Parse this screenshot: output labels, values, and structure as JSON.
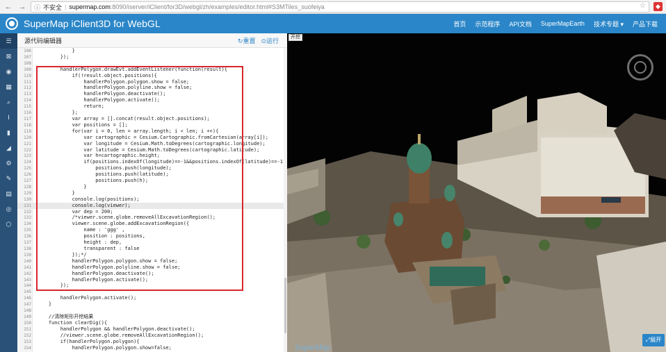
{
  "browser": {
    "back_icon": "arrow-left",
    "forward_icon": "arrow-right",
    "security_label": "不安全",
    "url_host": "supermap.com",
    "url_path": ":8090/iserver/iClient/for3D/webgl/zh/examples/editor.html#S3MTiles_suofeiya",
    "star_icon": "star"
  },
  "header": {
    "title": "SuperMap iClient3D for WebGL",
    "nav": [
      "首页",
      "示范程序",
      "API文档",
      "SuperMapEarth",
      "技术专题 ▾",
      "产品下载"
    ]
  },
  "sidebar": {
    "items": [
      "☰",
      "⊠",
      "◉",
      "▦",
      "⌕",
      "Ⅰ",
      "▮",
      "◢",
      "⚙",
      "✎",
      "▤",
      "◎",
      "⬡"
    ]
  },
  "editor": {
    "title": "源代码编辑器",
    "reset_label": "↻重置",
    "run_label": "⊙运行",
    "lines": [
      {
        "no": "106",
        "code": "            }"
      },
      {
        "no": "107",
        "code": "        });"
      },
      {
        "no": "108",
        "code": ""
      },
      {
        "no": "109",
        "code": "        handlerPolygon.drawEvt.addEventListener(function(result){"
      },
      {
        "no": "110",
        "code": "            if(!result.object.positions){"
      },
      {
        "no": "111",
        "code": "                handlerPolygon.polygon.show = false;"
      },
      {
        "no": "112",
        "code": "                handlerPolygon.polyline.show = false;"
      },
      {
        "no": "113",
        "code": "                handlerPolygon.deactivate();"
      },
      {
        "no": "114",
        "code": "                handlerPolygon.activate();"
      },
      {
        "no": "115",
        "code": "                return;"
      },
      {
        "no": "116",
        "code": "            };"
      },
      {
        "no": "117",
        "code": "            var array = [].concat(result.object.positions);"
      },
      {
        "no": "118",
        "code": "            var positions = [];"
      },
      {
        "no": "119",
        "code": "            for(var i = 0, len = array.length; i < len; i ++){"
      },
      {
        "no": "120",
        "code": "                var cartographic = Cesium.Cartographic.fromCartesian(array[i]);"
      },
      {
        "no": "121",
        "code": "                var longitude = Cesium.Math.toDegrees(cartographic.longitude);"
      },
      {
        "no": "122",
        "code": "                var latitude = Cesium.Math.toDegrees(cartographic.latitude);"
      },
      {
        "no": "123",
        "code": "                var h=cartographic.height;"
      },
      {
        "no": "124",
        "code": "                if(positions.indexOf(longitude)==-1&&positions.indexOf(latitude)==-1){"
      },
      {
        "no": "125",
        "code": "                    positions.push(longitude);"
      },
      {
        "no": "126",
        "code": "                    positions.push(latitude);"
      },
      {
        "no": "127",
        "code": "                    positions.push(h);"
      },
      {
        "no": "128",
        "code": "                }"
      },
      {
        "no": "129",
        "code": "            }"
      },
      {
        "no": "130",
        "code": "            console.log(positions);"
      },
      {
        "no": "131",
        "code": "            console.log(viewer);"
      },
      {
        "no": "132",
        "code": "            var dep = 200;"
      },
      {
        "no": "133",
        "code": "            /*viewer.scene.globe.removeAllExcavationRegion();"
      },
      {
        "no": "134",
        "code": "            viewer.scene.globe.addExcavationRegion({"
      },
      {
        "no": "135",
        "code": "                name : 'ggg' ,"
      },
      {
        "no": "136",
        "code": "                position : positions,"
      },
      {
        "no": "137",
        "code": "                height : dep,"
      },
      {
        "no": "138",
        "code": "                transparent : false"
      },
      {
        "no": "139",
        "code": "            });*/"
      },
      {
        "no": "140",
        "code": "            handlerPolygon.polygon.show = false;"
      },
      {
        "no": "141",
        "code": "            handlerPolygon.polyline.show = false;"
      },
      {
        "no": "142",
        "code": "            handlerPolygon.deactivate();"
      },
      {
        "no": "143",
        "code": "            handlerPolygon.activate();"
      },
      {
        "no": "144",
        "code": "        });"
      },
      {
        "no": "145",
        "code": ""
      },
      {
        "no": "146",
        "code": "        handlerPolygon.activate();"
      },
      {
        "no": "147",
        "code": "    }"
      },
      {
        "no": "148",
        "code": ""
      },
      {
        "no": "149",
        "code": "    //清除矩形开挖结果"
      },
      {
        "no": "150",
        "code": "    function clearDig(){"
      },
      {
        "no": "151",
        "code": "        handlerPolygon && handlerPolygon.deactivate();"
      },
      {
        "no": "152",
        "code": "        //viewer.scene.globe.removeAllExcavationRegion();"
      },
      {
        "no": "153",
        "code": "        if(handlerPolygon.polygon){"
      },
      {
        "no": "154",
        "code": "            handlerPolygon.polygon.show=false;"
      }
    ]
  },
  "viewer": {
    "run_tag": "开挖",
    "expand_label": "⤢展开",
    "credit": "SuperMap"
  }
}
